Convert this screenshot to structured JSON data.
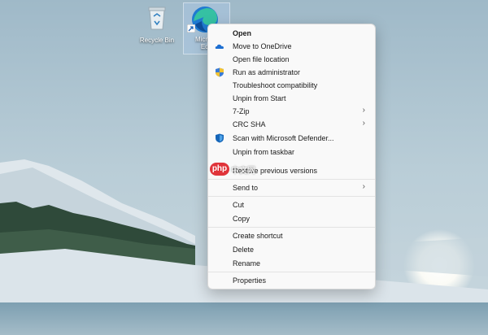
{
  "desktop": {
    "icons": [
      {
        "label": "Recycle Bin",
        "icon": "recycle-bin-icon"
      },
      {
        "label_lines": [
          "Microso",
          "Edg"
        ],
        "icon": "edge-icon"
      }
    ]
  },
  "context_menu": {
    "items": [
      {
        "label": "Open",
        "bold": true
      },
      {
        "label": "Move to OneDrive",
        "icon": "onedrive-cloud-icon"
      },
      {
        "label": "Open file location"
      },
      {
        "label": "Run as administrator",
        "icon": "uac-shield-icon"
      },
      {
        "label": "Troubleshoot compatibility"
      },
      {
        "label": "Unpin from Start"
      },
      {
        "label": "7-Zip",
        "submenu": true
      },
      {
        "label": "CRC SHA",
        "submenu": true
      },
      {
        "label": "Scan with Microsoft Defender...",
        "icon": "defender-shield-icon"
      },
      {
        "label": "Unpin from taskbar"
      },
      {
        "label": "Restore previous versions"
      },
      {
        "label": "Send to",
        "submenu": true
      },
      {
        "label": "Cut"
      },
      {
        "label": "Copy"
      },
      {
        "label": "Create shortcut"
      },
      {
        "label": "Delete"
      },
      {
        "label": "Rename"
      },
      {
        "label": "Properties"
      }
    ],
    "submenu_arrow": "›"
  },
  "watermark": {
    "text_a": "php",
    "text_b": "中文网"
  },
  "colors": {
    "accent": "#0067c0",
    "menu_bg": "#f9f9f9",
    "sky_top": "#9fb9c8",
    "snow": "#e8eef3"
  }
}
